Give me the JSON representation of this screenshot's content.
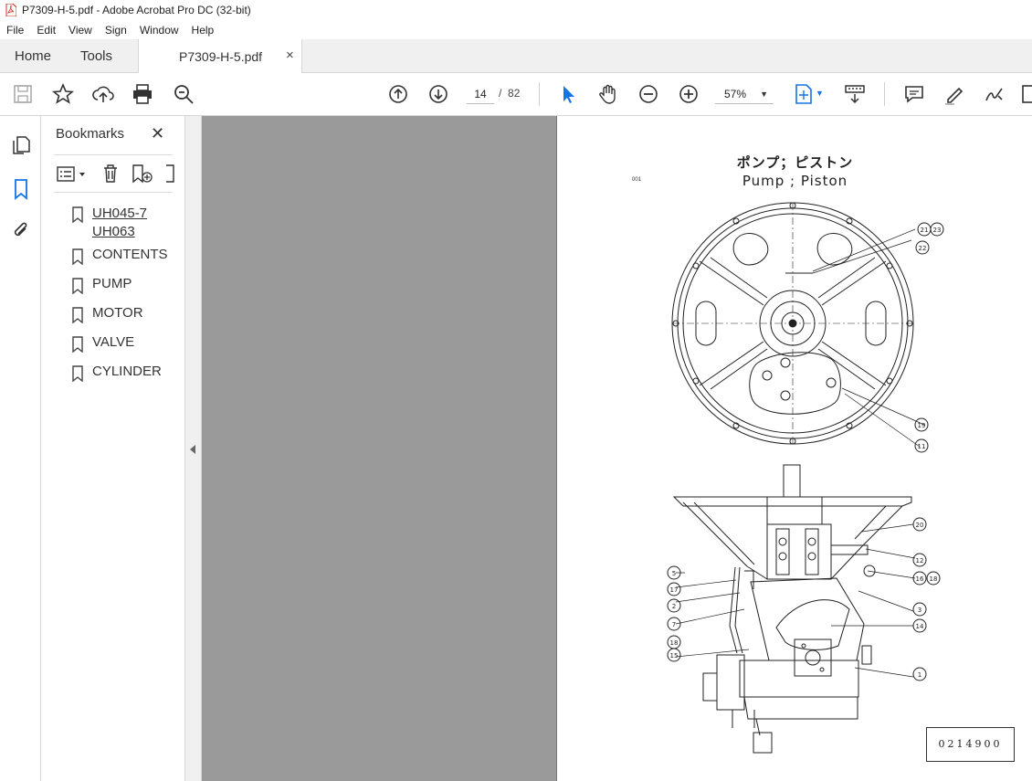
{
  "window": {
    "title": "P7309-H-5.pdf - Adobe Acrobat Pro DC (32-bit)"
  },
  "menu": [
    "File",
    "Edit",
    "View",
    "Sign",
    "Window",
    "Help"
  ],
  "tabs": {
    "home": "Home",
    "tools": "Tools",
    "document": "P7309-H-5.pdf",
    "close": "×"
  },
  "toolbar": {
    "current_page": "14",
    "page_separator": "/",
    "total_pages": "82",
    "zoom": "57%"
  },
  "bookmarks": {
    "title": "Bookmarks",
    "close": "✕",
    "items": [
      {
        "label": "UH045-7",
        "label2": "UH063"
      },
      {
        "label": "CONTENTS"
      },
      {
        "label": "PUMP"
      },
      {
        "label": "MOTOR"
      },
      {
        "label": "VALVE"
      },
      {
        "label": "CYLINDER"
      }
    ]
  },
  "document": {
    "title_jp": "ポンプ；ピストン",
    "title_en": "Pump ; Piston",
    "fig_ref": "001",
    "doc_number": "0214900",
    "callouts_top": [
      "21",
      "23",
      "22",
      "19",
      "11"
    ],
    "callouts_left": [
      "5",
      "17",
      "2",
      "7",
      "18",
      "15"
    ],
    "callouts_right": [
      "20",
      "12",
      "16",
      "18",
      "3",
      "14",
      "1"
    ]
  },
  "colors": {
    "accent": "#1473e6",
    "canvas": "#9a9a9a",
    "chrome": "#f0f0f0"
  }
}
